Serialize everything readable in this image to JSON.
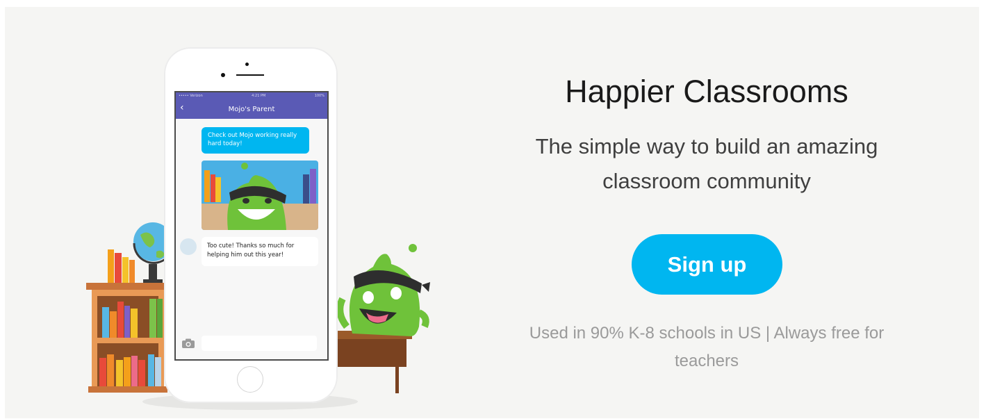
{
  "hero": {
    "headline": "Happier Classrooms",
    "subhead_line1": "The simple way to build an amazing",
    "subhead_line2": "classroom community",
    "signup_label": "Sign up",
    "footnote_line1": "Used in 90% K-8 schools in US | Always free for",
    "footnote_line2": "teachers"
  },
  "phone": {
    "status_left": "••••• Verizon",
    "status_center": "4:21 PM",
    "status_right": "100%",
    "chat_title": "Mojo's Parent",
    "message_out": "Check out Mojo working really hard today!",
    "message_in": "Too cute! Thanks so much for helping him out this year!"
  },
  "colors": {
    "accent": "#00b6f0",
    "chat_header": "#5a5ab5",
    "background": "#f5f5f3",
    "monster_green": "#6fc23a"
  },
  "icons": [
    "back-chevron-icon",
    "camera-icon"
  ]
}
